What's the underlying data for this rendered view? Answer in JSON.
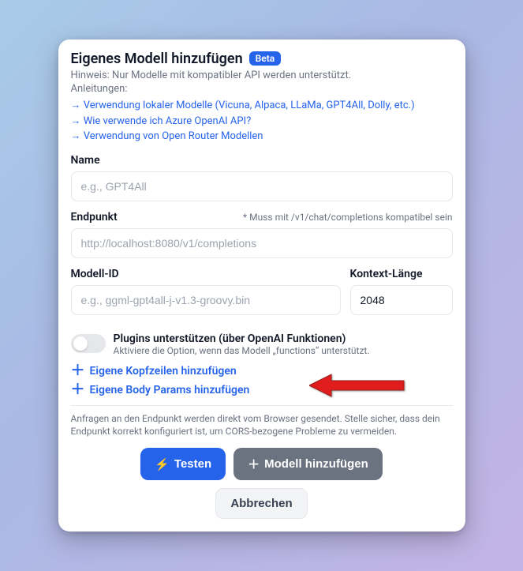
{
  "header": {
    "title": "Eigenes Modell hinzufügen",
    "badge": "Beta",
    "hint": "Hinweis: Nur Modelle mit kompatibler API werden unterstützt.",
    "guide_label": "Anleitungen:",
    "links": [
      "→ Verwendung lokaler Modelle (Vicuna, Alpaca, LLaMa, GPT4All, Dolly, etc.)",
      "→ Wie verwende ich Azure OpenAI API?",
      "→ Verwendung von Open Router Modellen"
    ]
  },
  "fields": {
    "name": {
      "label": "Name",
      "placeholder": "e.g., GPT4All",
      "value": ""
    },
    "endpoint": {
      "label": "Endpunkt",
      "note": "* Muss mit /v1/chat/completions kompatibel sein",
      "placeholder": "http://localhost:8080/v1/completions",
      "value": ""
    },
    "model_id": {
      "label": "Modell-ID",
      "placeholder": "e.g., ggml-gpt4all-j-v1.3-groovy.bin",
      "value": ""
    },
    "context_length": {
      "label": "Kontext-Länge",
      "value": "2048"
    }
  },
  "plugins": {
    "title": "Plugins unterstützen (über OpenAI Funktionen)",
    "sub": "Aktiviere die Option, wenn das Modell „functions“ unterstützt.",
    "enabled": false
  },
  "add_actions": {
    "headers": "Eigene Kopfzeilen hinzufügen",
    "body_params": "Eigene Body Params hinzufügen"
  },
  "footnote": "Anfragen an den Endpunkt werden direkt vom Browser gesendet. Stelle sicher, dass dein Endpunkt korrekt konfiguriert ist, um CORS-bezogene Probleme zu vermeiden.",
  "buttons": {
    "test": "Testen",
    "add": "Modell hinzufügen",
    "cancel": "Abbrechen"
  },
  "icons": {
    "bolt": "⚡",
    "plus": "＋"
  }
}
